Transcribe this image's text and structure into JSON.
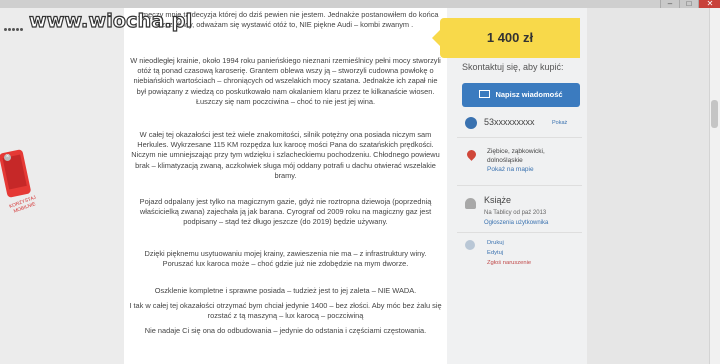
{
  "window": {
    "minimize": "–",
    "maximize": "□",
    "close": "✕"
  },
  "watermark": {
    "text": "www.wiocha.pl"
  },
  "ad": {
    "label_line1": "KORZYSTAJ",
    "label_line2": "MOBILNIE"
  },
  "article": {
    "paragraphs": [
      "… męczy mnie ta decyzja której do dziś pewien nie jestem. Jednakże postanowiłem do końca szczęśliwy, odważam się wystawić otóż to, NIE piękne Audi – kombi zwanym .",
      "W nieodległej krainie, około 1994 roku panieńskiego nieznani rzemieślnicy pełni mocy stworzyli otóż tą ponad czasową karoserię. Grantem oblewa wszy ją – stworzyli cudowna powłokę o niebiańskich wartościach – chroniących od wszelakich mocy szatana. Jednakże ich zapał nie był powiązany z wiedzą co poskutkowało nam okalaniem klaru przez te kilkanaście wiosen. Łuszczy się nam poczciwina – choć to nie jest jej wina.",
      "W całej tej okazałości jest też wiele znakomitości, silnik potężny ona posiada niczym sam Herkules. Wykrzesane 115 KM rozpędza lux karocę mości Pana do szatańskich prędkości. Niczym nie umniejszając przy tym wdzięku i szlacheckiemu pochodzeniu. Chłodnego powiewu brak – klimatyzacją zwaną, aczkolwiek sługa mój oddany potrafi u dachu otwierać wszelakie bramy.",
      "Pojazd odpalany jest tylko na magicznym gazie, gdyż nie roztropna dziewoja (poprzednią właścicielką zwana) zajechała ją jak barana. Cyrograf od 2009 roku na magiczny gaz jest podpisany – stąd też długo jeszcze (do 2019) będzie używany.",
      "Dzięki pięknemu usytuowaniu mojej krainy, zawieszenia nie ma – z infrastruktury winy. Poruszać lux karoca może – choć gdzie już nie zdobędzie na mym dworze.",
      "Oszklenie kompletne i sprawne posiada – tudzież jest to jej zaleta – NIE WADA.",
      "I tak w całej tej okazałości otrzymać bym chciał jedynie 1400 – bez złości. Aby móc bez żalu się rozstać z tą maszyną – lux karocą – poczciwiną",
      "Nie nadaje Ci się ona do odbudowania – jedynie do odstania i częściami częstowania."
    ]
  },
  "sidebar": {
    "price": "1 400 zł",
    "contact_heading": "Skontaktuj się, aby kupić:",
    "message_button": "Napisz wiadomość",
    "phone": "53xxxxxxxxx",
    "phone_show": "Pokaż",
    "location_line1": "Ziębice, ząbkowicki,",
    "location_line2": "dolnośląskie",
    "map_link": "Pokaż na mapie",
    "user_name": "Książe",
    "user_since": "Na Tablicy od paź 2013",
    "user_ads": "Ogłoszenia użytkownika",
    "actions": [
      "Drukuj",
      "Edytuj",
      "Zgłoś naruszenie"
    ]
  }
}
